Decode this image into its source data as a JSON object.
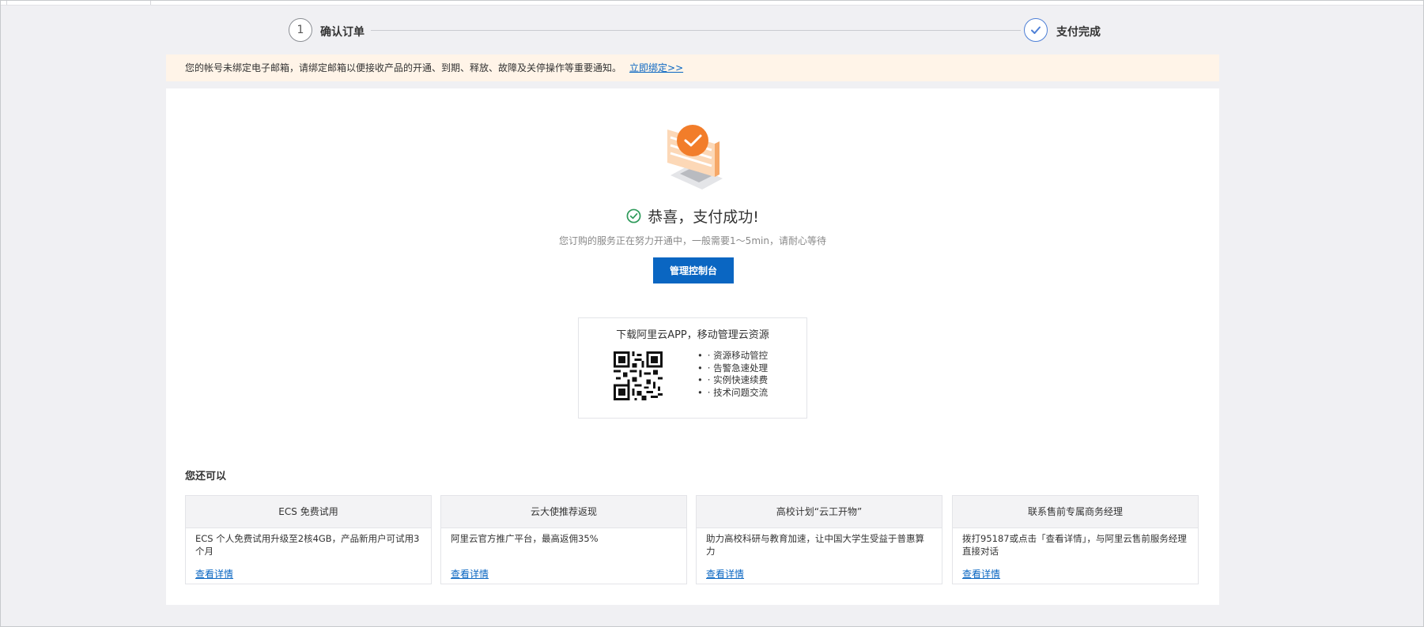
{
  "steps": [
    {
      "number": "1",
      "label": "确认订单"
    },
    {
      "label": "支付完成"
    }
  ],
  "notice": {
    "text": "您的帐号未绑定电子邮箱，请绑定邮箱以便接收产品的开通、到期、释放、故障及关停操作等重要通知。",
    "link": "立即绑定>>"
  },
  "success": {
    "title": "恭喜，支付成功!",
    "subtitle": "您订购的服务正在努力开通中，一般需要1～5min，请耐心等待",
    "button": "管理控制台"
  },
  "app": {
    "title": "下载阿里云APP，移动管理云资源",
    "features": [
      "· 资源移动管控",
      "· 告警急速处理",
      "· 实例快速续费",
      "· 技术问题交流"
    ]
  },
  "more": {
    "title": "您还可以",
    "cards": [
      {
        "title": "ECS 免费试用",
        "desc": "ECS 个人免费试用升级至2核4GB，产品新用户可试用3个月",
        "link": "查看详情"
      },
      {
        "title": "云大使推荐返现",
        "desc": "阿里云官方推广平台，最高返佣35%",
        "link": "查看详情"
      },
      {
        "title": "高校计划“云工开物”",
        "desc": "助力高校科研与教育加速，让中国大学生受益于普惠算力",
        "link": "查看详情"
      },
      {
        "title": "联系售前专属商务经理",
        "desc": "拨打95187或点击「查看详情」，与阿里云售前服务经理直接对话",
        "link": "查看详情"
      }
    ]
  },
  "colors": {
    "primary": "#0a66c2",
    "notice_bg": "#fff4e8",
    "success_green": "#2e9a5a",
    "illustration_orange": "#f27d2a",
    "step_done_blue": "#4d7fd6"
  },
  "icons": {
    "step_done": "check-icon",
    "success": "check-circle-icon"
  }
}
